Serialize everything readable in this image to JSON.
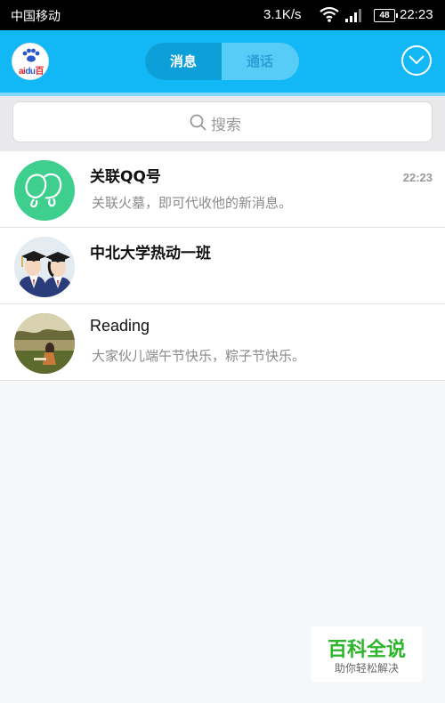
{
  "status_bar": {
    "carrier": "中国移动",
    "net_speed": "3.1K/s",
    "battery": "48",
    "time": "22:23"
  },
  "header": {
    "logo_text": "ai du 百",
    "tabs": [
      {
        "label": "消息",
        "active": true
      },
      {
        "label": "通话",
        "active": false
      }
    ]
  },
  "search": {
    "placeholder": "搜索"
  },
  "conversations": [
    {
      "name": "关联QQ号",
      "preview": "关联火墓，即可代收他的新消息。",
      "time": "22:23"
    },
    {
      "name": "中北大学热动一班",
      "preview": "",
      "time": ""
    },
    {
      "name": "Reading",
      "preview": "大家伙儿端午节快乐，粽子节快乐。",
      "time": ""
    }
  ],
  "watermark": {
    "title": "百科全说",
    "subtitle": "助你轻松解决"
  },
  "colors": {
    "header_blue": "#12b7f5",
    "tab_active": "#0d9fd8",
    "link_avatar_green": "#3ecf8e",
    "watermark_green": "#2db52b"
  }
}
